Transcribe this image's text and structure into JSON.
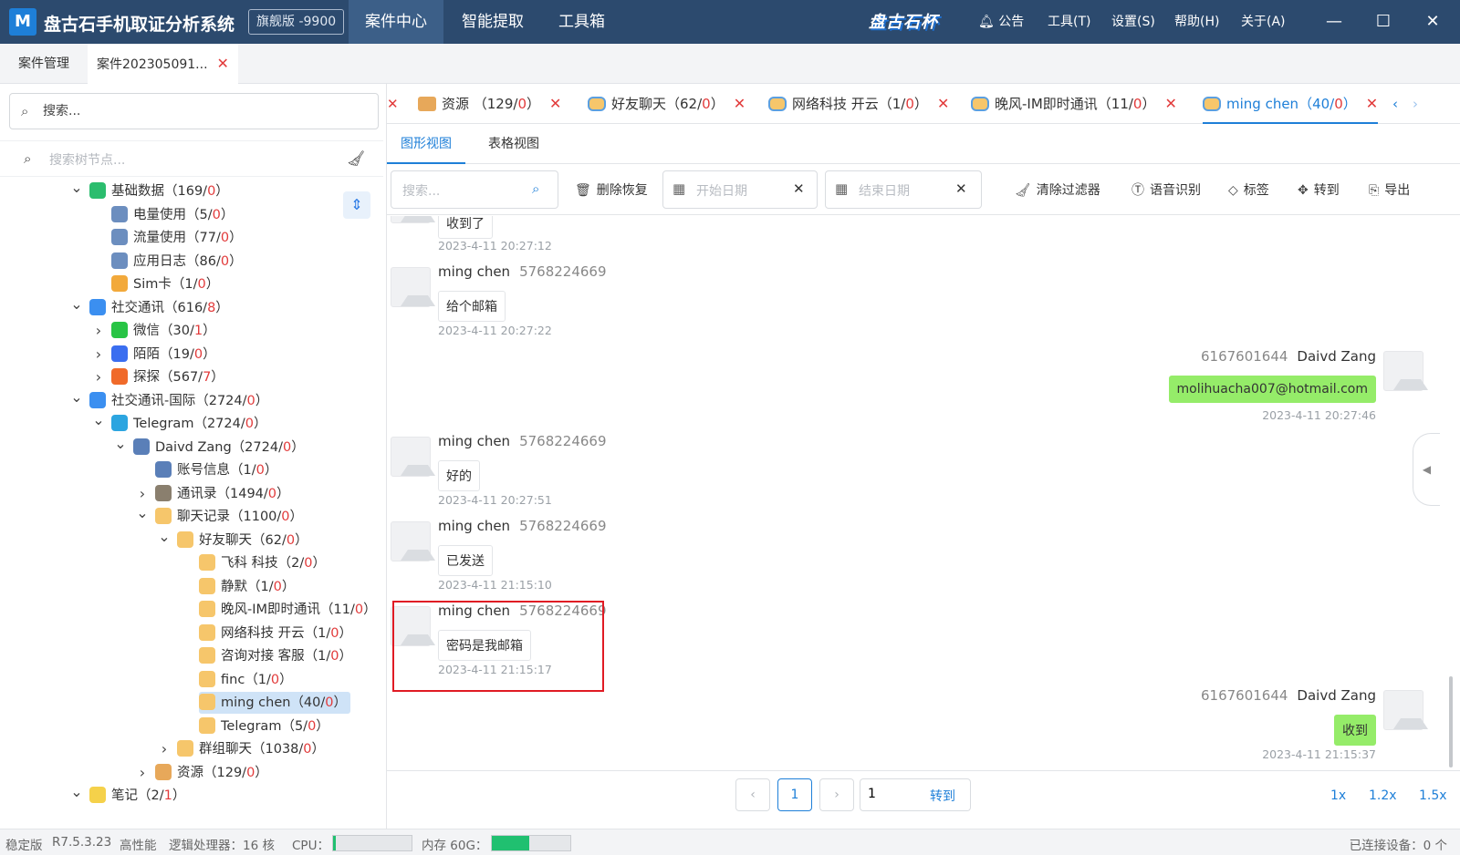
{
  "app": {
    "logo_letter": "M",
    "title": "盘古石手机取证分析系统",
    "edition": "旗舰版 -9900",
    "brand_logo": "盘古石杯",
    "nav": [
      "案件中心",
      "智能提取",
      "工具箱"
    ],
    "menu": {
      "notice": "公告",
      "tools": "工具(T)",
      "settings": "设置(S)",
      "help": "帮助(H)",
      "about": "关于(A)"
    },
    "window": {
      "min": "—",
      "max": "☐",
      "close": "✕"
    }
  },
  "case_tabs": [
    {
      "label": "案件管理"
    },
    {
      "label": "案件202305091..."
    }
  ],
  "left": {
    "search_placeholder": "搜索...",
    "tree_search_placeholder": "搜索树节点...",
    "tree": [
      {
        "label": "基础数据（169/",
        "red": "0",
        "end": "）",
        "arrow": "v",
        "icon": "data-icon",
        "color": "#2bbd6e"
      },
      {
        "label": "电量使用（5/",
        "red": "0",
        "end": "）",
        "arrow": "",
        "icon": "battery-icon",
        "color": "#6c8ebf"
      },
      {
        "label": "流量使用（77/",
        "red": "0",
        "end": "）",
        "arrow": "",
        "icon": "traffic-icon",
        "color": "#6c8ebf"
      },
      {
        "label": "应用日志（86/",
        "red": "0",
        "end": "）",
        "arrow": "",
        "icon": "log-icon",
        "color": "#6c8ebf"
      },
      {
        "label": "Sim卡（1/",
        "red": "0",
        "end": "）",
        "arrow": "",
        "icon": "sim-icon",
        "color": "#f2a93b"
      },
      {
        "label": "社交通讯（616/",
        "red": "8",
        "end": "）",
        "arrow": "v",
        "icon": "social-icon",
        "color": "#3b8ff0"
      },
      {
        "label": "微信（30/",
        "red": "1",
        "end": "）",
        "arrow": ">",
        "icon": "wechat-icon",
        "color": "#28c445"
      },
      {
        "label": "陌陌（19/",
        "red": "0",
        "end": "）",
        "arrow": ">",
        "icon": "momo-icon",
        "color": "#3a6ef0"
      },
      {
        "label": "探探（567/",
        "red": "7",
        "end": "）",
        "arrow": ">",
        "icon": "tantan-icon",
        "color": "#f06a2a"
      },
      {
        "label": "社交通讯-国际（2724/",
        "red": "0",
        "end": "）",
        "arrow": "v",
        "icon": "social-intl-icon",
        "color": "#3b8ff0"
      },
      {
        "label": "Telegram（2724/",
        "red": "0",
        "end": "）",
        "arrow": "v",
        "icon": "telegram-icon",
        "color": "#2ca5e0"
      },
      {
        "label": "Daivd Zang（2724/",
        "red": "0",
        "end": "）",
        "arrow": "v",
        "icon": "user-icon",
        "color": "#5a7fb8"
      },
      {
        "label": "账号信息（1/",
        "red": "0",
        "end": "）",
        "arrow": "",
        "icon": "account-icon",
        "color": "#5a7fb8"
      },
      {
        "label": "通讯录（1494/",
        "red": "0",
        "end": "）",
        "arrow": ">",
        "icon": "contacts-icon",
        "color": "#8a7f6e"
      },
      {
        "label": "聊天记录（1100/",
        "red": "0",
        "end": "）",
        "arrow": "v",
        "icon": "chat-icon",
        "color": "#f6c66b"
      },
      {
        "label": "好友聊天（62/",
        "red": "0",
        "end": "）",
        "arrow": "v",
        "icon": "chat-icon",
        "color": "#f6c66b"
      },
      {
        "label": "飞科 科技（2/",
        "red": "0",
        "end": "）",
        "arrow": "",
        "icon": "chat-icon",
        "color": "#f6c66b"
      },
      {
        "label": "静默（1/",
        "red": "0",
        "end": "）",
        "arrow": "",
        "icon": "chat-icon",
        "color": "#f6c66b"
      },
      {
        "label": "晚风-IM即时通讯（11/",
        "red": "0",
        "end": "）",
        "arrow": "",
        "icon": "chat-icon",
        "color": "#f6c66b"
      },
      {
        "label": "网络科技 开云（1/",
        "red": "0",
        "end": "）",
        "arrow": "",
        "icon": "chat-icon",
        "color": "#f6c66b"
      },
      {
        "label": "咨询对接 客服（1/",
        "red": "0",
        "end": "）",
        "arrow": "",
        "icon": "chat-icon",
        "color": "#f6c66b"
      },
      {
        "label": "finc（1/",
        "red": "0",
        "end": "）",
        "arrow": "",
        "icon": "chat-icon",
        "color": "#f6c66b"
      },
      {
        "label": "ming chen（40/",
        "red": "0",
        "end": "）",
        "arrow": "",
        "icon": "chat-icon",
        "color": "#f6c66b",
        "selected": true
      },
      {
        "label": "Telegram（5/",
        "red": "0",
        "end": "）",
        "arrow": "",
        "icon": "chat-icon",
        "color": "#f6c66b"
      },
      {
        "label": "群组聊天（1038/",
        "red": "0",
        "end": "）",
        "arrow": ">",
        "icon": "chat-icon",
        "color": "#f6c66b"
      },
      {
        "label": "资源（129/",
        "red": "0",
        "end": "）",
        "arrow": ">",
        "icon": "resource-icon",
        "color": "#e7a85a"
      },
      {
        "label": "笔记（2/",
        "red": "1",
        "end": "）",
        "arrow": "v",
        "icon": "note-icon",
        "color": "#f5d14a"
      }
    ]
  },
  "subtabs": [
    {
      "label": "资源 （129/",
      "red": "0",
      "end": "）",
      "icon": "resource-icon"
    },
    {
      "label": "好友聊天（62/",
      "red": "0",
      "end": "）",
      "icon": "chat-icon"
    },
    {
      "label": "网络科技 开云（1/",
      "red": "0",
      "end": "）",
      "icon": "chat-icon"
    },
    {
      "label": "晚风-IM即时通讯（11/",
      "red": "0",
      "end": "）",
      "icon": "chat-icon"
    },
    {
      "label": "ming chen（40/",
      "red": "0",
      "end": "）",
      "icon": "chat-icon",
      "active": true
    }
  ],
  "view_tabs": [
    "图形视图",
    "表格视图"
  ],
  "toolbar": {
    "search_placeholder": "搜索...",
    "delete_recover": "删除恢复",
    "start_date": "开始日期",
    "end_date": "结束日期",
    "clear_filter": "清除过滤器",
    "speech": "语音识别",
    "tag": "标签",
    "goto": "转到",
    "export": "导出"
  },
  "messages": [
    {
      "dir": "in",
      "sender": "",
      "uid": "",
      "text": "收到了",
      "time": "2023-4-11 20:27:12"
    },
    {
      "dir": "in",
      "sender": "ming chen",
      "uid": "5768224669",
      "text": "给个邮箱",
      "time": "2023-4-11 20:27:22"
    },
    {
      "dir": "out",
      "sender": "Daivd Zang",
      "uid": "6167601644",
      "text": "molihuacha007@hotmail.com",
      "time": "2023-4-11 20:27:46"
    },
    {
      "dir": "in",
      "sender": "ming chen",
      "uid": "5768224669",
      "text": "好的",
      "time": "2023-4-11 20:27:51"
    },
    {
      "dir": "in",
      "sender": "ming chen",
      "uid": "5768224669",
      "text": "已发送",
      "time": "2023-4-11 21:15:10"
    },
    {
      "dir": "in",
      "sender": "ming chen",
      "uid": "5768224669",
      "text": "密码是我邮箱",
      "time": "2023-4-11 21:15:17"
    },
    {
      "dir": "out",
      "sender": "Daivd Zang",
      "uid": "6167601644",
      "text": "收到",
      "time": "2023-4-11 21:15:37"
    }
  ],
  "pager": {
    "current": "1",
    "goto_value": "1",
    "goto_label": "转到",
    "prev": "‹",
    "next": "›",
    "speeds": [
      "1x",
      "1.2x",
      "1.5x"
    ]
  },
  "status": {
    "version_label": "稳定版",
    "version": "R7.5.3.23",
    "perf": "高性能",
    "cpu_cores": "逻辑处理器：16 核",
    "cpu_label": "CPU：",
    "cpu_level": 0.03,
    "mem_label": "内存 60G：",
    "mem_level": 0.48,
    "devices": "已连接设备：0 个"
  }
}
